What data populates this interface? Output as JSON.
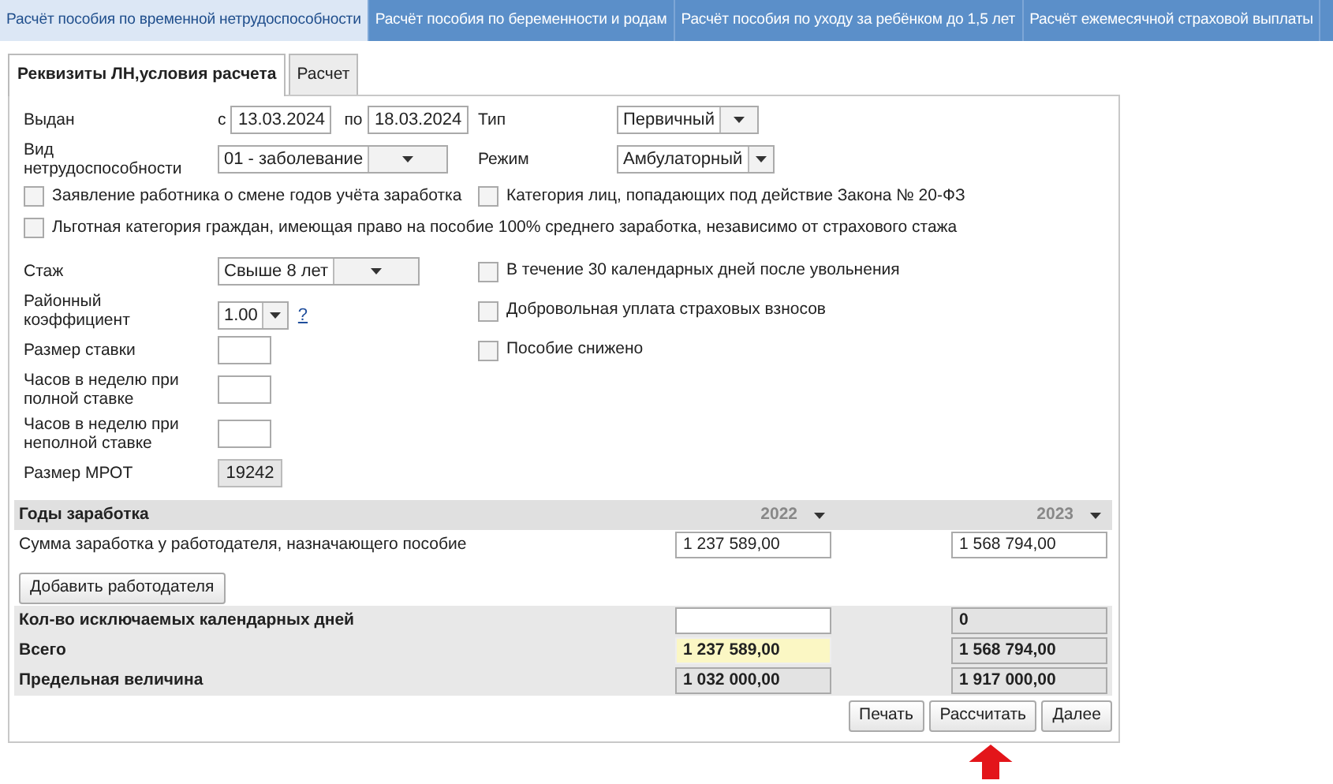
{
  "top_tabs": [
    {
      "label": "Расчёт пособия по временной нетрудоспособности",
      "selected": true
    },
    {
      "label": "Расчёт пособия по беременности и родам",
      "selected": false
    },
    {
      "label": "Расчёт пособия по уходу за ребёнком до 1,5 лет",
      "selected": false
    },
    {
      "label": "Расчёт ежемесячной страховой выплаты",
      "selected": false
    }
  ],
  "sub_tabs": [
    {
      "label": "Реквизиты ЛН,условия расчета",
      "selected": true
    },
    {
      "label": "Расчет",
      "selected": false
    }
  ],
  "form": {
    "issued": {
      "label": "Выдан",
      "from_label": "с",
      "from": "13.03.2024",
      "to_label": "по",
      "to": "18.03.2024"
    },
    "type": {
      "label": "Тип",
      "value": "Первичный"
    },
    "disability_kind": {
      "label": "Вид нетрудоспособности",
      "value": "01 - заболевание"
    },
    "mode": {
      "label": "Режим",
      "value": "Амбулаторный"
    },
    "change_years": {
      "label": "Заявление работника о смене годов учёта заработка",
      "checked": false
    },
    "law_20fz": {
      "label": "Категория лиц, попадающих под действие Закона № 20-ФЗ",
      "checked": false
    },
    "privileged": {
      "label": "Льготная категория граждан, имеющая право на пособие 100% среднего заработка, независимо от страхового стажа",
      "checked": false
    },
    "experience": {
      "label": "Стаж",
      "value": "Свыше 8 лет"
    },
    "after_dismissal": {
      "label": "В течение 30 календарных дней после увольнения",
      "checked": false
    },
    "regional_coef": {
      "label": "Районный коэффициент",
      "value": "1.00",
      "help": "?"
    },
    "voluntary": {
      "label": "Добровольная уплата страховых взносов",
      "checked": false
    },
    "rate": {
      "label": "Размер ставки"
    },
    "reduced": {
      "label": "Пособие снижено",
      "checked": false
    },
    "hours_full": {
      "label": "Часов в неделю при полной ставке"
    },
    "hours_part": {
      "label": "Часов в неделю при неполной ставке"
    },
    "mrot": {
      "label": "Размер МРОТ",
      "value": "19242"
    }
  },
  "earnings": {
    "header": {
      "label": "Годы заработка",
      "years": [
        "2022",
        "2023"
      ]
    },
    "employer_rows": [
      {
        "label": "Сумма заработка у работодателя, назначающего пособие",
        "cells": [
          {
            "kind": "input",
            "value": "1 237 589,00"
          },
          {
            "kind": "input",
            "value": "1 568 794,00"
          }
        ]
      }
    ],
    "add_button": "Добавить работодателя",
    "summary_rows": [
      {
        "label": "Кол-во исключаемых календарных дней",
        "cells": [
          {
            "kind": "input"
          },
          {
            "kind": "readonly",
            "value": "0"
          }
        ]
      },
      {
        "label": "Всего",
        "cells": [
          {
            "kind": "highlight",
            "value": "1 237 589,00"
          },
          {
            "kind": "readonly",
            "value": "1 568 794,00"
          }
        ]
      },
      {
        "label": "Предельная величина",
        "cells": [
          {
            "kind": "readonly",
            "value": "1 032 000,00"
          },
          {
            "kind": "readonly",
            "value": "1 917 000,00"
          }
        ]
      }
    ]
  },
  "buttons": [
    "Печать",
    "Рассчитать",
    "Далее"
  ]
}
